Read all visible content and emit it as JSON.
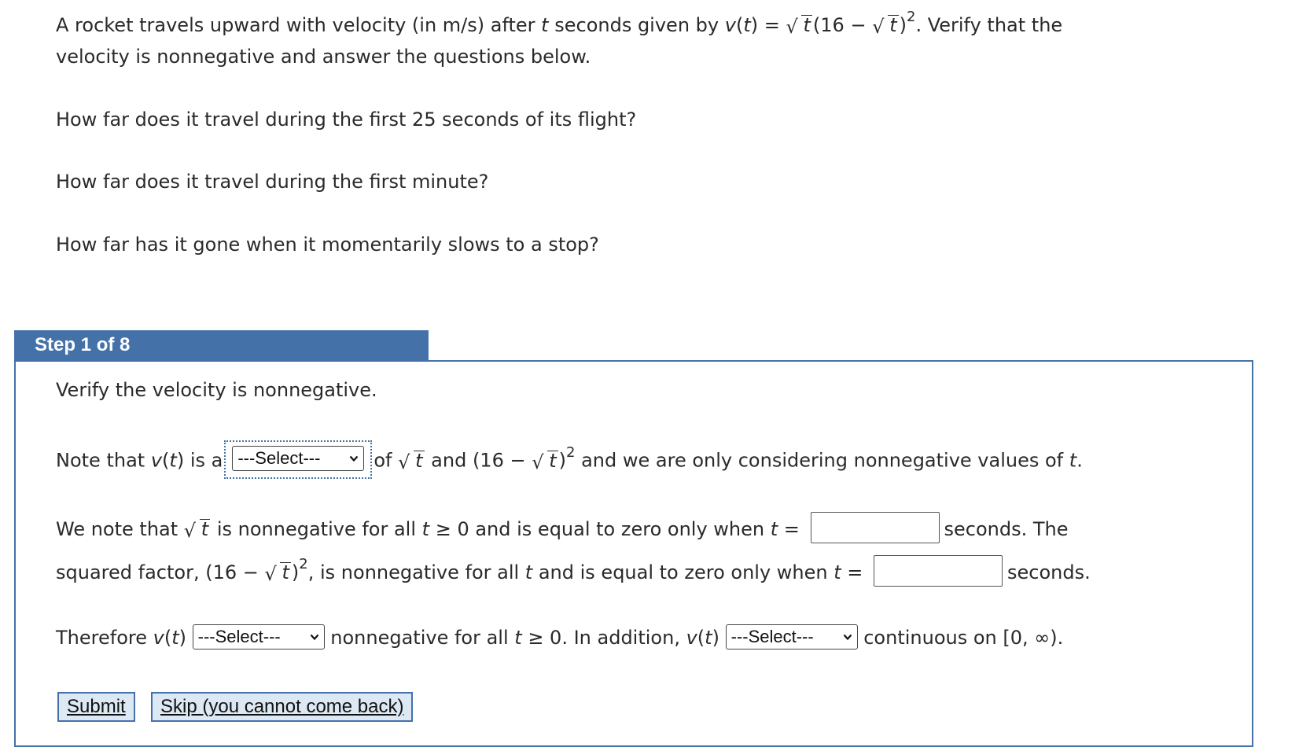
{
  "problem": {
    "line1_a": "A rocket travels upward with velocity (in m/s) after ",
    "t": "t",
    "line1_b": " seconds given by ",
    "v": "v",
    "paren_open": "(",
    "paren_close": ")",
    "equals": " = ",
    "sixteen_minus": "(16 − ",
    "close_sq": ")",
    "exp2": "2",
    "line1_c": ". Verify that the",
    "line2": "velocity is nonnegative and answer the questions below."
  },
  "questions": [
    "How far does it travel during the first 25 seconds of its flight?",
    "How far does it travel during the first minute?",
    "How far has it gone when it momentarily slows to a stop?"
  ],
  "step": {
    "label": "Step 1 of 8",
    "instruction": "Verify the velocity is nonnegative.",
    "note_a": "Note that ",
    "note_b": " is a",
    "note_c": "of ",
    "note_d": " and ",
    "note_e": " and we are only considering nonnegative values of ",
    "note_end": ".",
    "we_a": "We note that ",
    "we_b": " is nonnegative for all ",
    "geq0": " ≥ 0 and is equal to zero only when ",
    "eq": " = ",
    "seconds_the": "seconds. The",
    "sq_a": "squared factor, ",
    "sq_b": ", is nonnegative for all ",
    "sq_c": " and is equal to zero only when ",
    "seconds": "seconds.",
    "there_a": "Therefore ",
    "there_b": "nonnegative for all ",
    "there_c": " ≥ 0. In addition, ",
    "there_d": "continuous on [0, ∞).",
    "select_placeholder": "---Select---"
  },
  "buttons": {
    "submit": "Submit",
    "skip": "Skip (you cannot come back)"
  },
  "colors": {
    "accent": "#4472a8",
    "button_bg": "#dde8f5"
  }
}
